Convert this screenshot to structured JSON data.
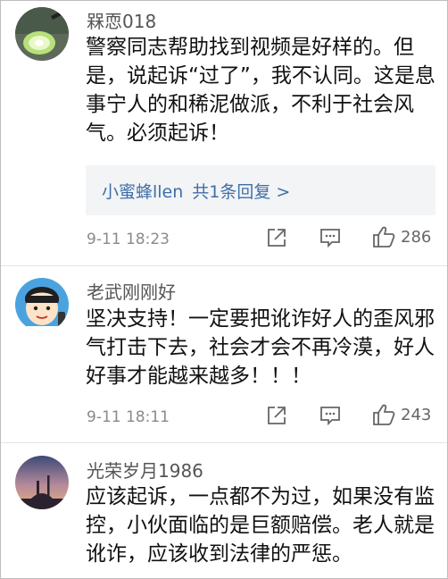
{
  "comments": [
    {
      "username": "槑恧018",
      "text": "警察同志帮助找到视频是好样的。但是，说起诉“过了”，我不认同。这是息事宁人的和稀泥做派，不利于社会风气。必须起诉！",
      "reply": {
        "user": "小蜜蜂llen",
        "summary": "共1条回复 >"
      },
      "timestamp": "9-11 18:23",
      "likes": "286"
    },
    {
      "username": "老武刚刚好",
      "text": "坚决支持！一定要把讹诈好人的歪风邪气打击下去，社会才会不再冷漠，好人好事才能越来越多！！！",
      "timestamp": "9-11 18:11",
      "likes": "243"
    },
    {
      "username": "光荣岁月1986",
      "text": "应该起诉，一点都不为过，如果没有监控，小伙面临的是巨额赔偿。老人就是讹诈，应该收到法律的严惩。"
    }
  ],
  "icons": {
    "share": "share-icon",
    "comment": "comment-icon",
    "like": "thumbs-up-icon"
  },
  "colors": {
    "reply_link": "#3e6fa8",
    "reply_bg": "#f3f4f6",
    "meta": "#8a8a8a"
  }
}
